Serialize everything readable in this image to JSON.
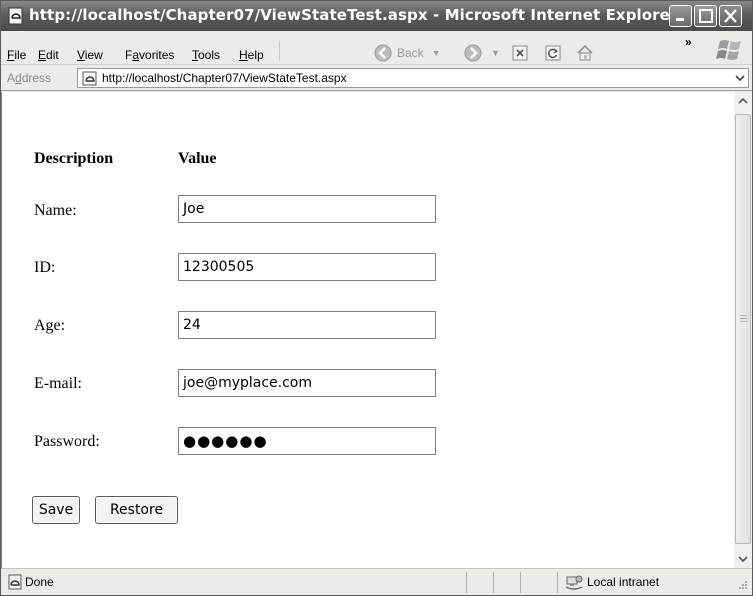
{
  "window": {
    "title": "http://localhost/Chapter07/ViewStateTest.aspx - Microsoft Internet Explorer"
  },
  "menu": {
    "items": [
      {
        "pre": "",
        "u": "F",
        "post": "ile"
      },
      {
        "pre": "",
        "u": "E",
        "post": "dit"
      },
      {
        "pre": "",
        "u": "V",
        "post": "iew"
      },
      {
        "pre": "F",
        "u": "a",
        "post": "vorites"
      },
      {
        "pre": "",
        "u": "T",
        "post": "ools"
      },
      {
        "pre": "",
        "u": "H",
        "post": "elp"
      }
    ],
    "back_label": "Back"
  },
  "address": {
    "label": "Address",
    "label_u": "d",
    "url": "http://localhost/Chapter07/ViewStateTest.aspx"
  },
  "form": {
    "header_description": "Description",
    "header_value": "Value",
    "fields": [
      {
        "label": "Name:",
        "value": "Joe"
      },
      {
        "label": "ID:",
        "value": "12300505"
      },
      {
        "label": "Age:",
        "value": "24"
      },
      {
        "label": "E-mail:",
        "value": "joe@myplace.com"
      },
      {
        "label": "Password:",
        "value": "●●●●●●"
      }
    ],
    "save_label": "Save",
    "restore_label": "Restore"
  },
  "status": {
    "text": "Done",
    "zone": "Local intranet"
  }
}
